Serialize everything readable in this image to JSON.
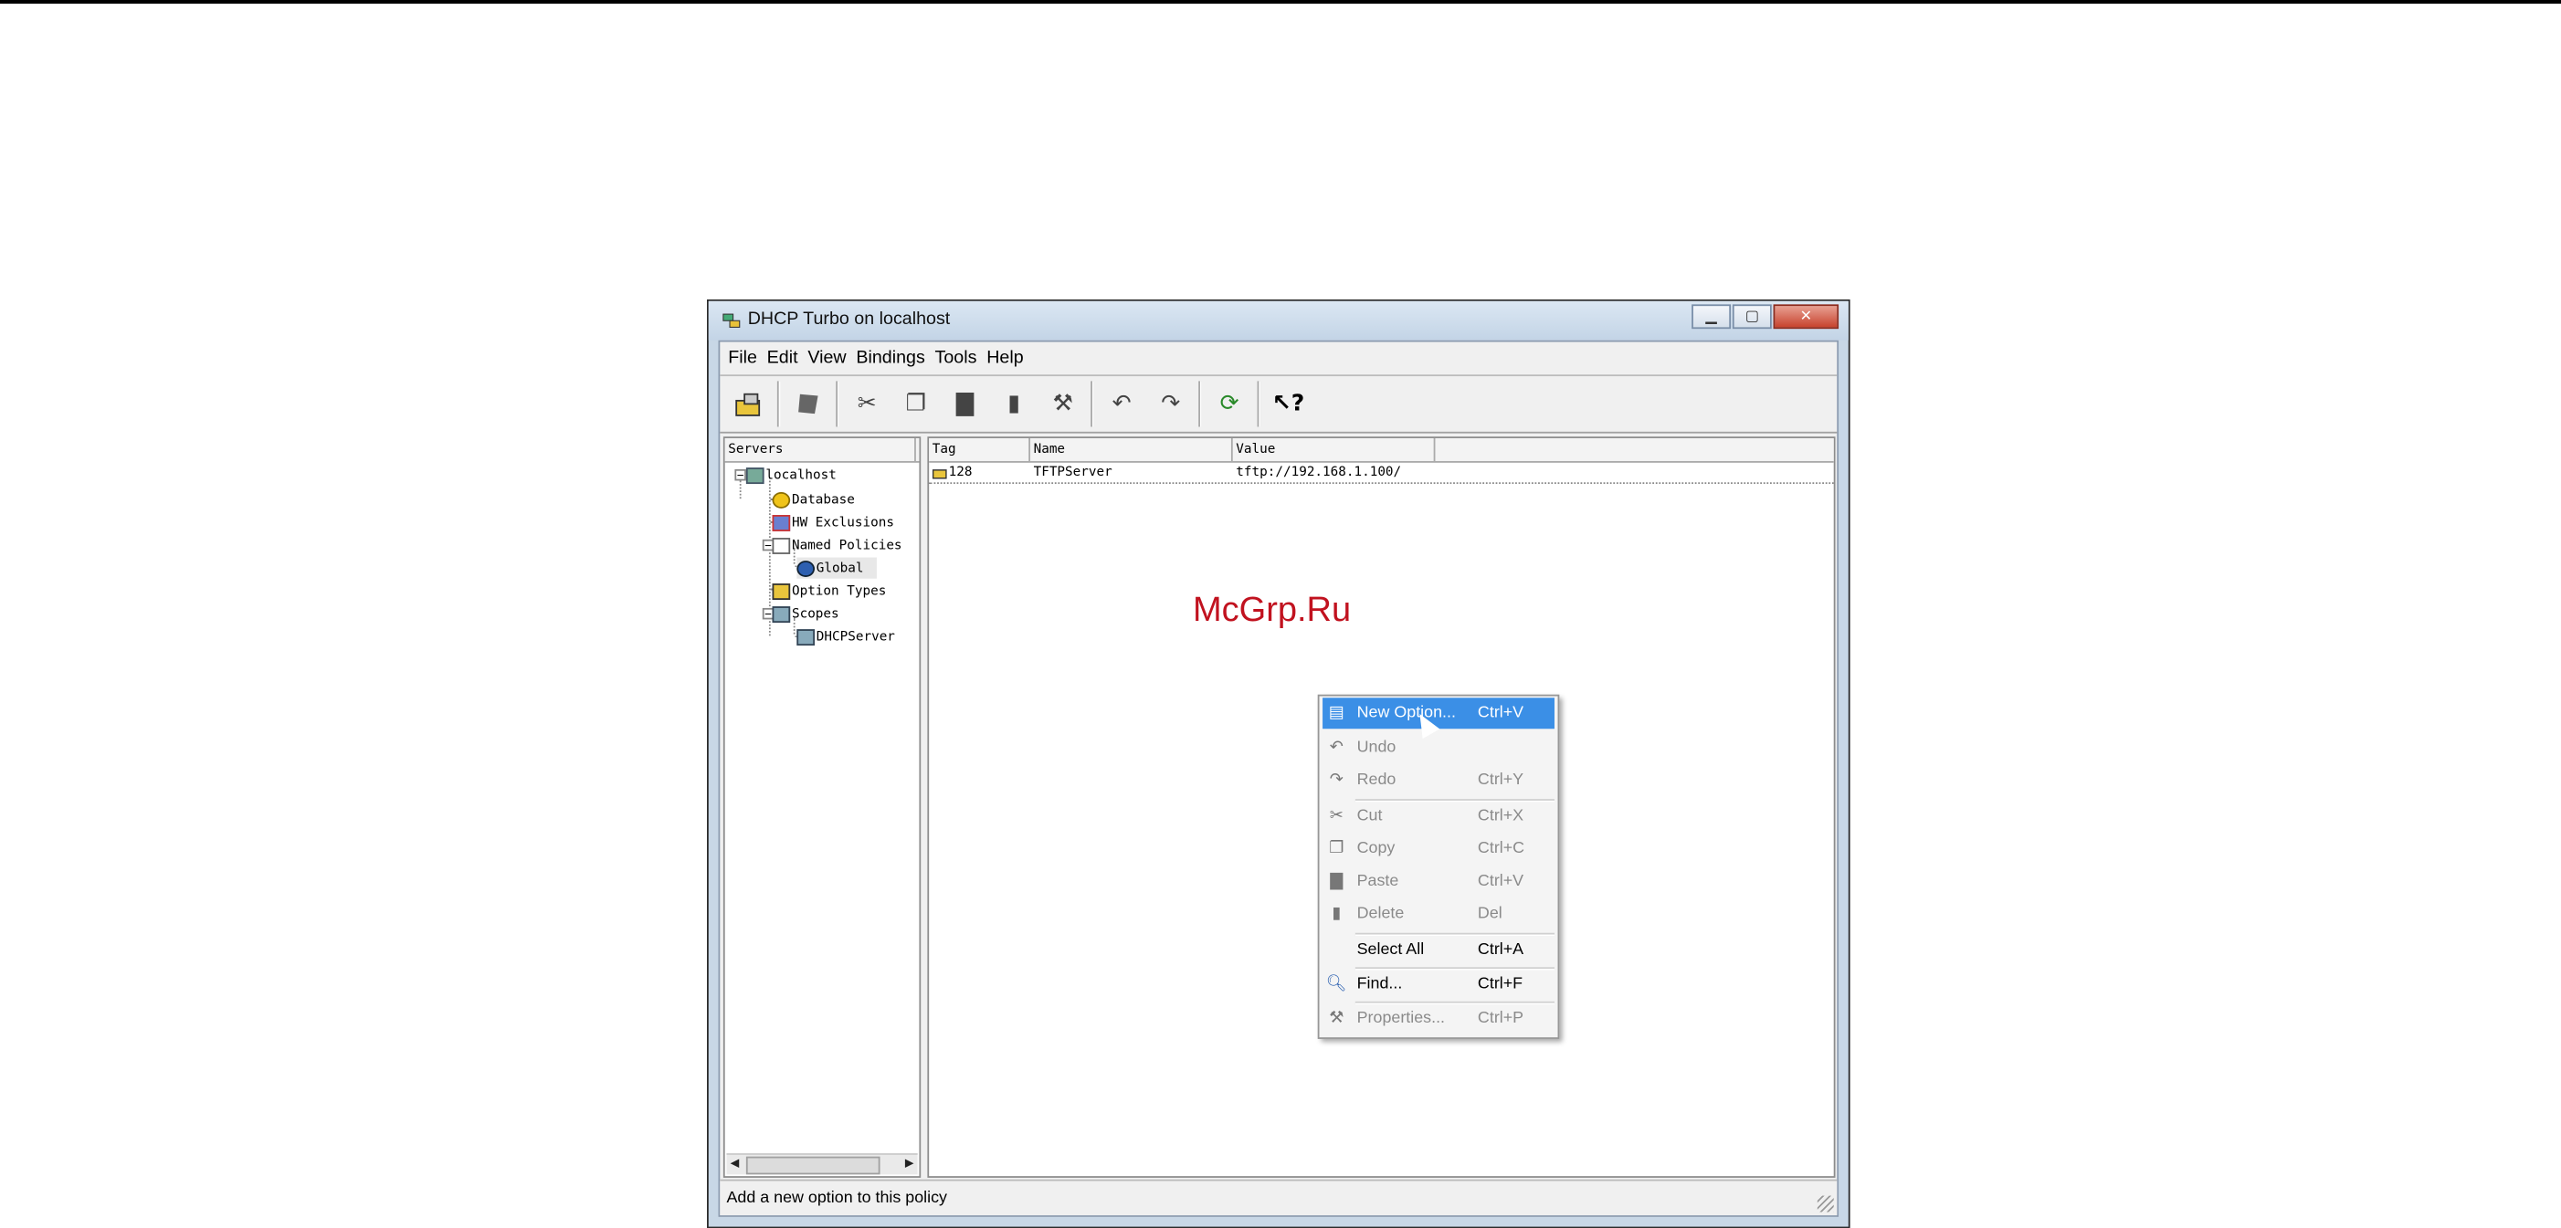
{
  "window": {
    "title": "DHCP Turbo on localhost"
  },
  "menubar": [
    "File",
    "Edit",
    "View",
    "Bindings",
    "Tools",
    "Help"
  ],
  "toolbar_icons": [
    "new-server-icon",
    "database-icon",
    "cut-icon",
    "copy-icon",
    "paste-icon",
    "delete-icon",
    "properties-icon",
    "undo-icon",
    "redo-icon",
    "refresh-icon",
    "context-help-icon"
  ],
  "left_pane": {
    "column": "Servers",
    "tree": [
      "localhost",
      "Database",
      "HW Exclusions",
      "Named Policies",
      "Global",
      "Option Types",
      "Scopes",
      "DHCPServer"
    ]
  },
  "right_pane": {
    "columns": [
      "Tag",
      "Name",
      "Value"
    ],
    "rows": [
      {
        "tag": "128",
        "name": "TFTPServer",
        "value": "tftp://192.168.1.100/"
      }
    ]
  },
  "context_menu": {
    "items": [
      {
        "label": "New Option...",
        "shortcut": "Ctrl+V",
        "icon": "new-option-icon",
        "state": "highlighted"
      },
      {
        "label": "Undo",
        "shortcut": "",
        "icon": "undo-icon",
        "state": "disabled"
      },
      {
        "label": "Redo",
        "shortcut": "Ctrl+Y",
        "icon": "redo-icon",
        "state": "disabled"
      },
      {
        "label": "Cut",
        "shortcut": "Ctrl+X",
        "icon": "cut-icon",
        "state": "disabled"
      },
      {
        "label": "Copy",
        "shortcut": "Ctrl+C",
        "icon": "copy-icon",
        "state": "disabled"
      },
      {
        "label": "Paste",
        "shortcut": "Ctrl+V",
        "icon": "paste-icon",
        "state": "disabled"
      },
      {
        "label": "Delete",
        "shortcut": "Del",
        "icon": "delete-icon",
        "state": "disabled"
      },
      {
        "label": "Select All",
        "shortcut": "Ctrl+A",
        "icon": "",
        "state": "enabled"
      },
      {
        "label": "Find...",
        "shortcut": "Ctrl+F",
        "icon": "find-icon",
        "state": "enabled"
      },
      {
        "label": "Properties...",
        "shortcut": "Ctrl+P",
        "icon": "properties-icon",
        "state": "disabled"
      }
    ]
  },
  "status": "Add a new option to this policy",
  "watermark": "McGrp.Ru",
  "colors": {
    "highlight": "#3b8fe6",
    "watermark": "#c1121f"
  }
}
